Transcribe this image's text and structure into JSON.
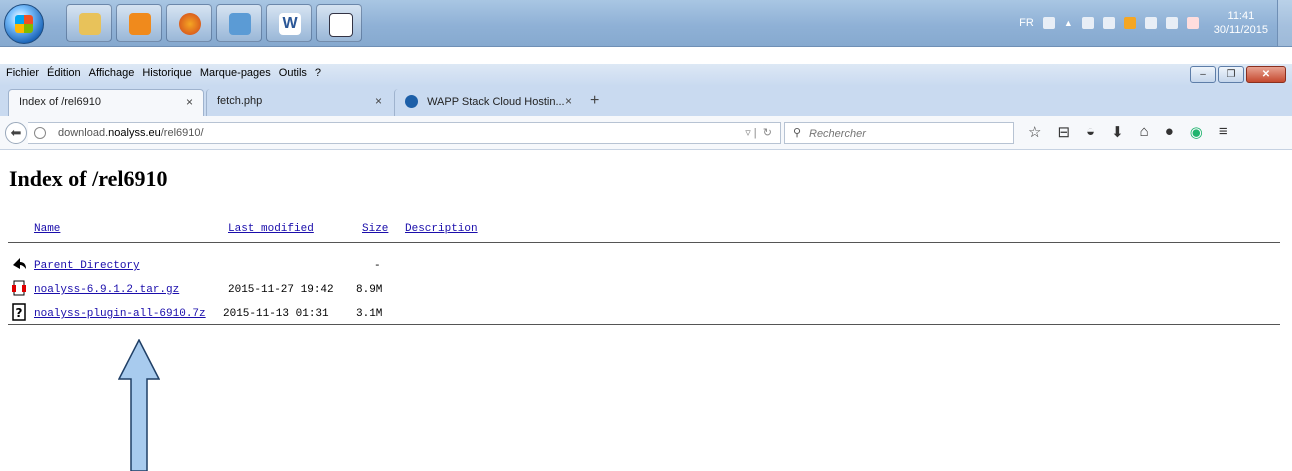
{
  "taskbar": {
    "apps": [
      "start-orb",
      "explorer-icon",
      "media-player-icon",
      "firefox-icon",
      "control-panel-icon",
      "word-icon",
      "notepad-icon"
    ],
    "tray": {
      "lang": "FR",
      "time": "11:41",
      "date": "30/11/2015"
    }
  },
  "menubar": {
    "items": [
      "Fichier",
      "Édition",
      "Affichage",
      "Historique",
      "Marque-pages",
      "Outils",
      "?"
    ]
  },
  "tabs": [
    {
      "label": "Index of /rel6910",
      "close": "×"
    },
    {
      "label": "fetch.php",
      "close": "×"
    },
    {
      "label": "WAPP Stack Cloud Hostin...",
      "close": "×"
    }
  ],
  "new_tab": "+",
  "navbar": {
    "url_prefix": "download.",
    "url_host": "noalyss.eu",
    "url_path": "/rel6910/",
    "search_placeholder": "Rechercher"
  },
  "page": {
    "title": "Index of /rel6910",
    "columns": {
      "name": "Name",
      "modified": "Last modified",
      "size": "Size",
      "description": "Description"
    },
    "rows": [
      {
        "name": "Parent Directory",
        "modified": "",
        "size": "-"
      },
      {
        "name": "noalyss-6.9.1.2.tar.gz",
        "modified": "2015-11-27 19:42",
        "size": "8.9M"
      },
      {
        "name": "noalyss-plugin-all-6910.7z",
        "modified": "2015-11-13 01:31",
        "size": "3.1M"
      }
    ]
  },
  "colors": {
    "link": "#1a0dab",
    "annotation_arrow": "#a8cbee"
  }
}
